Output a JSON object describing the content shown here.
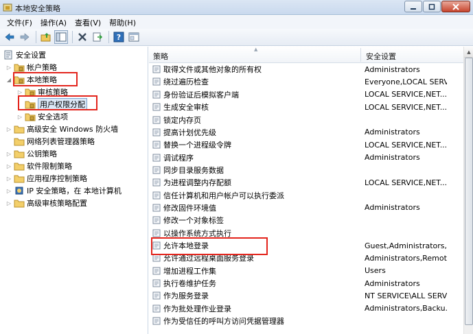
{
  "window": {
    "title": "本地安全策略"
  },
  "menu": [
    "文件(F)",
    "操作(A)",
    "查看(V)",
    "帮助(H)"
  ],
  "toolbar": {
    "icons": [
      "back-arrow-icon",
      "forward-arrow-icon",
      "up-folder-icon",
      "show-hide-tree-icon",
      "delete-icon",
      "export-list-icon",
      "help-icon",
      "properties-icon"
    ]
  },
  "tree": [
    {
      "label": "安全设置",
      "level": 0,
      "icon": "security-settings-icon"
    },
    {
      "label": "帐户策略",
      "level": 1,
      "icon": "folder-icon"
    },
    {
      "label": "本地策略",
      "level": 1,
      "icon": "folder-icon"
    },
    {
      "label": "审核策略",
      "level": 2,
      "icon": "folder-icon"
    },
    {
      "label": "用户权限分配",
      "level": 2,
      "icon": "folder-icon",
      "selected": true
    },
    {
      "label": "安全选项",
      "level": 2,
      "icon": "folder-icon"
    },
    {
      "label": "高级安全 Windows 防火墙",
      "level": 1,
      "icon": "folder-icon"
    },
    {
      "label": "网络列表管理器策略",
      "level": 1,
      "icon": "folder-icon"
    },
    {
      "label": "公钥策略",
      "level": 1,
      "icon": "folder-icon"
    },
    {
      "label": "软件限制策略",
      "level": 1,
      "icon": "folder-icon"
    },
    {
      "label": "应用程序控制策略",
      "level": 1,
      "icon": "folder-icon"
    },
    {
      "label": "IP 安全策略，在 本地计算机",
      "level": 1,
      "icon": "ip-security-icon"
    },
    {
      "label": "高级审核策略配置",
      "level": 1,
      "icon": "folder-icon"
    }
  ],
  "columns": {
    "policy": "策略",
    "setting": "安全设置"
  },
  "rows": [
    {
      "policy": "取得文件或其他对象的所有权",
      "setting": "Administrators"
    },
    {
      "policy": "绕过遍历检查",
      "setting": "Everyone,LOCAL SERV..."
    },
    {
      "policy": "身份验证后模拟客户端",
      "setting": "LOCAL SERVICE,NET..."
    },
    {
      "policy": "生成安全审核",
      "setting": "LOCAL SERVICE,NET..."
    },
    {
      "policy": "锁定内存页",
      "setting": ""
    },
    {
      "policy": "提高计划优先级",
      "setting": "Administrators"
    },
    {
      "policy": "替换一个进程级令牌",
      "setting": "LOCAL SERVICE,NET..."
    },
    {
      "policy": "调试程序",
      "setting": "Administrators"
    },
    {
      "policy": "同步目录服务数据",
      "setting": ""
    },
    {
      "policy": "为进程调整内存配额",
      "setting": "LOCAL SERVICE,NET..."
    },
    {
      "policy": "信任计算机和用户帐户可以执行委派",
      "setting": ""
    },
    {
      "policy": "修改固件环境值",
      "setting": "Administrators"
    },
    {
      "policy": "修改一个对象标签",
      "setting": ""
    },
    {
      "policy": "以操作系统方式执行",
      "setting": ""
    },
    {
      "policy": "允许本地登录",
      "setting": "Guest,Administrators,..."
    },
    {
      "policy": "允许通过远程桌面服务登录",
      "setting": "Administrators,Remot..."
    },
    {
      "policy": "增加进程工作集",
      "setting": "Users"
    },
    {
      "policy": "执行卷维护任务",
      "setting": "Administrators"
    },
    {
      "policy": "作为服务登录",
      "setting": "NT SERVICE\\ALL SERV..."
    },
    {
      "policy": "作为批处理作业登录",
      "setting": "Administrators,Backu..."
    },
    {
      "policy": "作为受信任的呼叫方访问凭据管理器",
      "setting": ""
    }
  ],
  "colors": {
    "highlight": "#e3231b",
    "selection": "#dbe8f7"
  }
}
